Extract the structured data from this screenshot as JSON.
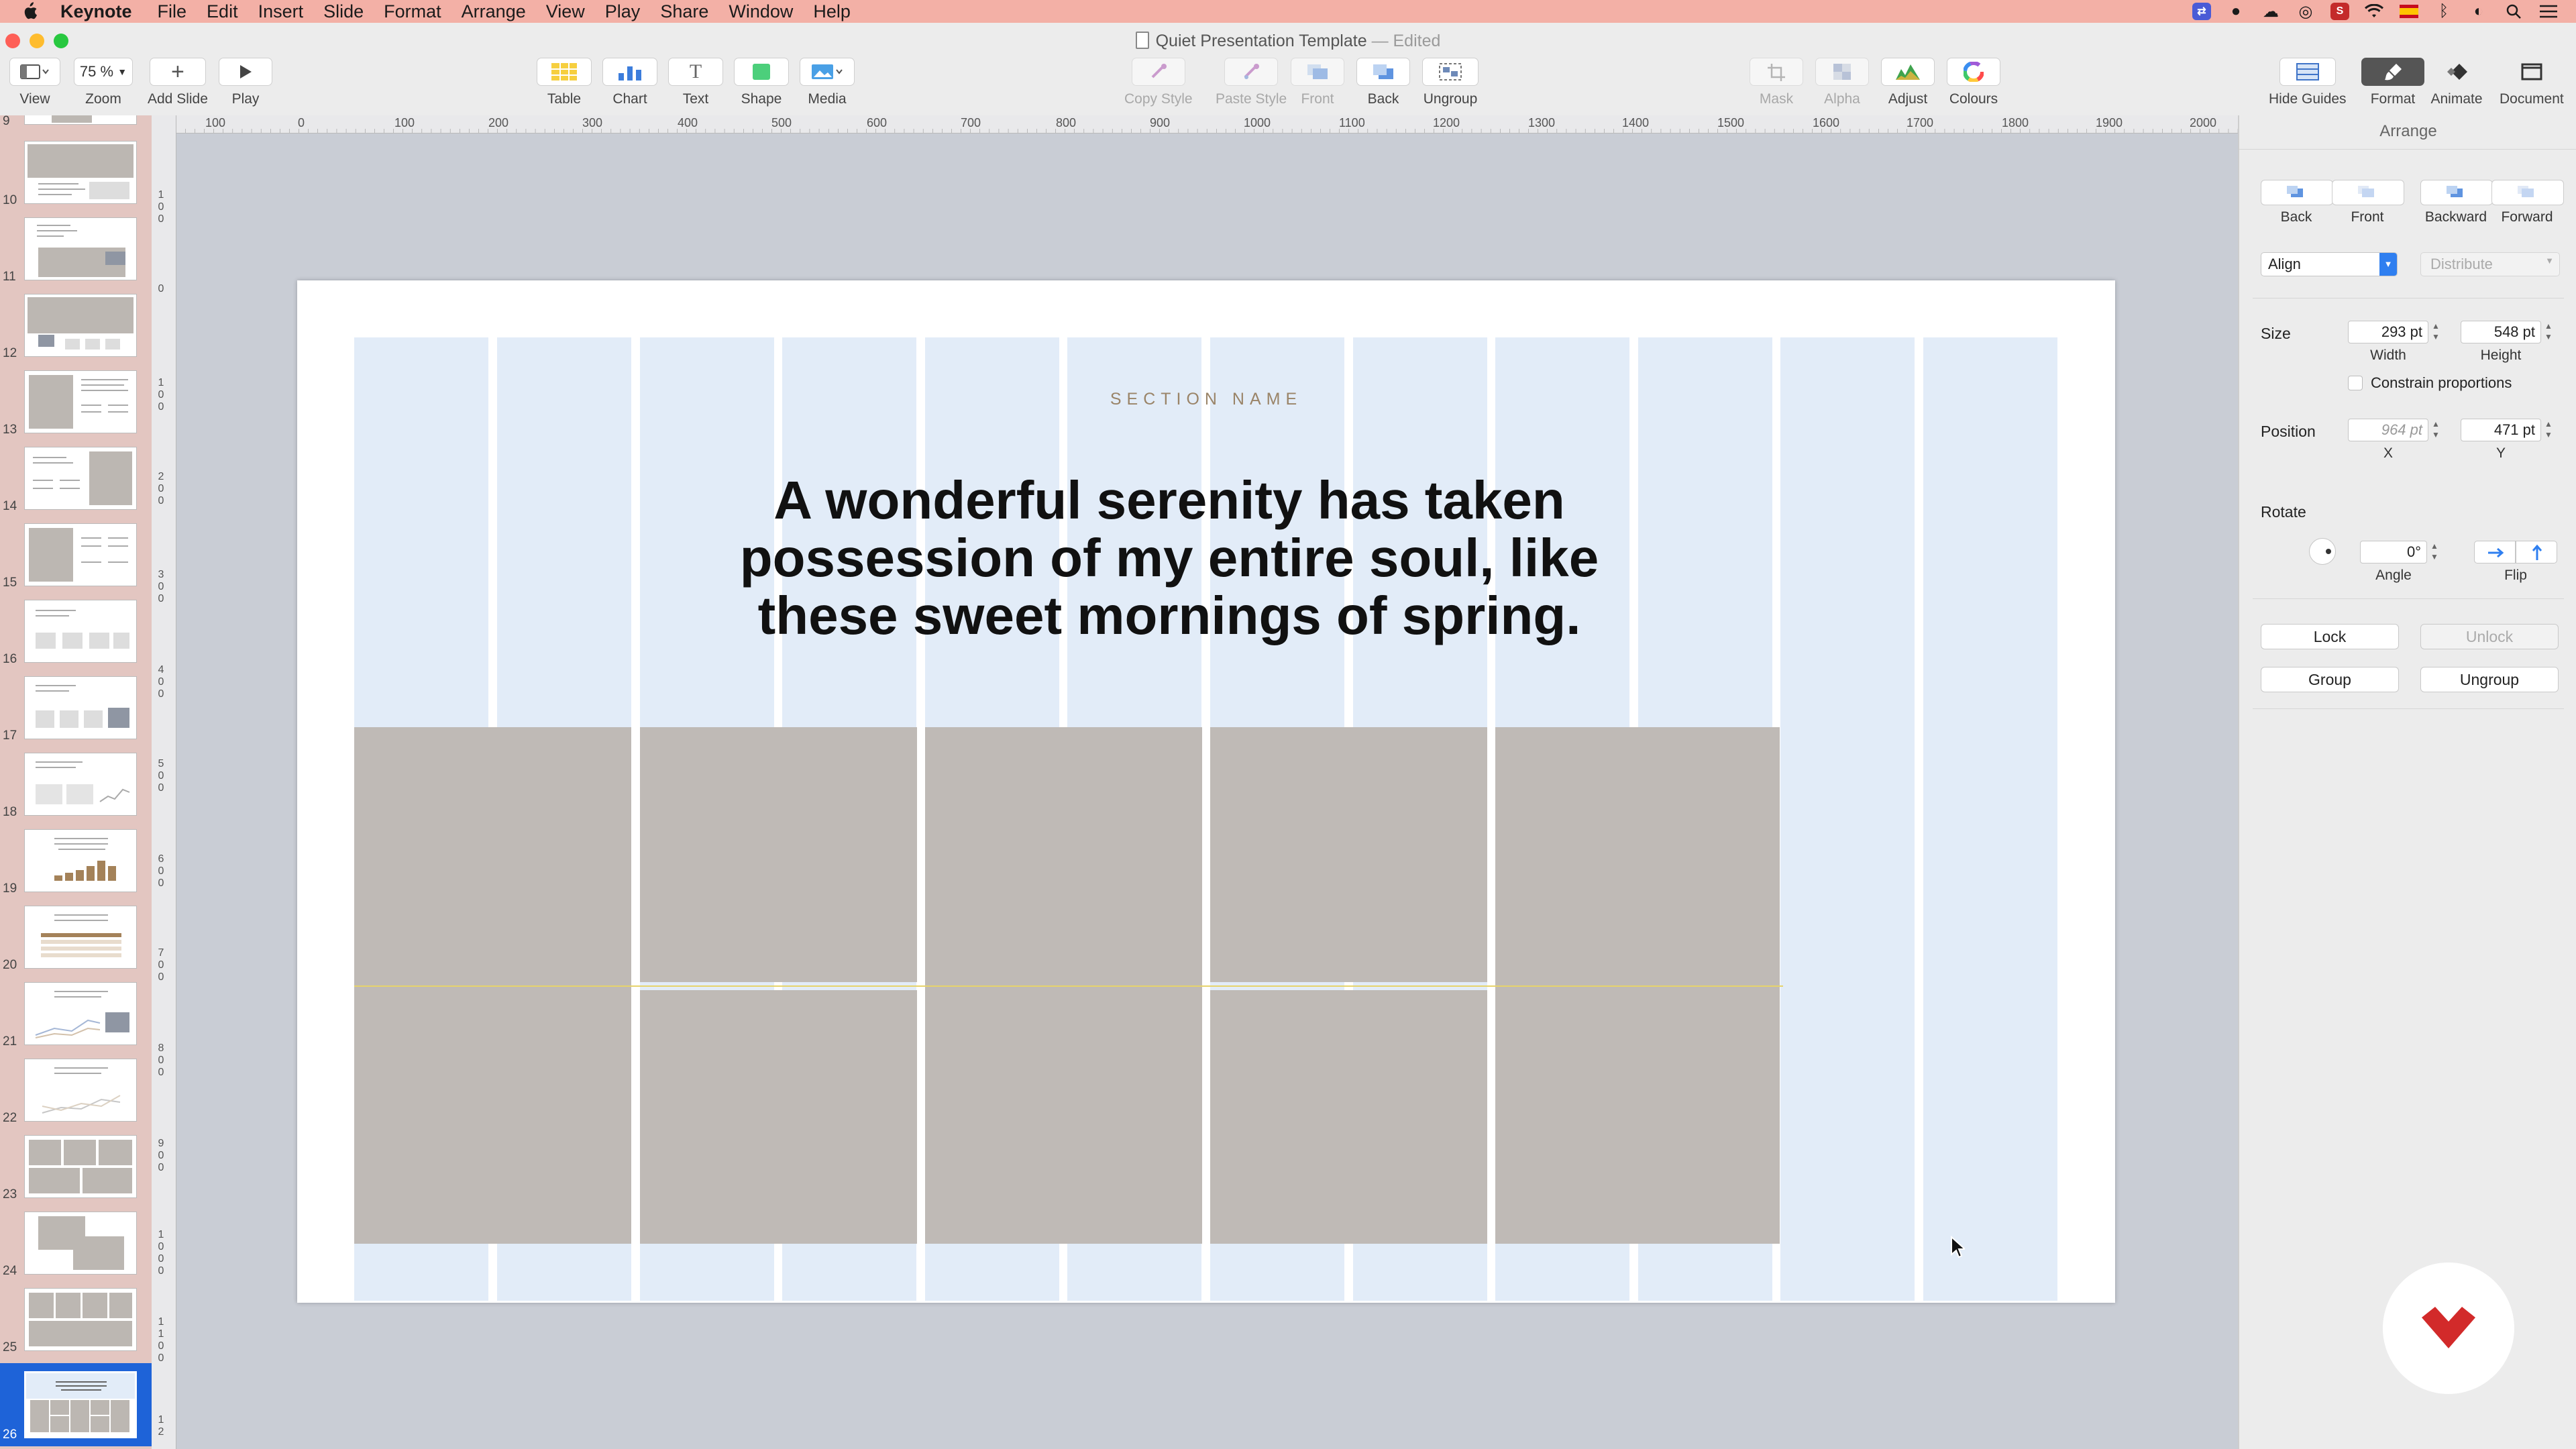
{
  "menubar": {
    "app": "Keynote",
    "items": [
      "File",
      "Edit",
      "Insert",
      "Slide",
      "Format",
      "Arrange",
      "View",
      "Play",
      "Share",
      "Window",
      "Help"
    ]
  },
  "window": {
    "title": "Quiet Presentation Template",
    "status": "— Edited"
  },
  "toolbar": {
    "view": "View",
    "zoom": "Zoom",
    "zoom_value": "75 %",
    "add_slide": "Add Slide",
    "play": "Play",
    "table": "Table",
    "chart": "Chart",
    "text": "Text",
    "shape": "Shape",
    "media": "Media",
    "copy_style": "Copy Style",
    "paste_style": "Paste Style",
    "front": "Front",
    "back": "Back",
    "ungroup": "Ungroup",
    "mask": "Mask",
    "alpha": "Alpha",
    "adjust": "Adjust",
    "colours": "Colours",
    "hide_guides": "Hide Guides",
    "format": "Format",
    "animate": "Animate",
    "document": "Document",
    "text_glyph": "T"
  },
  "navigator": {
    "slide_numbers": [
      "9",
      "10",
      "11",
      "12",
      "13",
      "14",
      "15",
      "16",
      "17",
      "18",
      "19",
      "20",
      "21",
      "22",
      "23",
      "24",
      "25",
      "26"
    ],
    "selected": "26"
  },
  "ruler": {
    "top_labels": [
      "100",
      "0",
      "100",
      "200",
      "300",
      "400",
      "500",
      "600",
      "700",
      "800",
      "900",
      "1000",
      "1100",
      "1200",
      "1300",
      "1400",
      "1500",
      "1600",
      "1700",
      "1800",
      "1900",
      "2000"
    ],
    "left_labels": [
      "100",
      "0",
      "100",
      "200",
      "300",
      "400",
      "500",
      "600",
      "700",
      "800",
      "900",
      "1000",
      "1100",
      "12"
    ]
  },
  "slide": {
    "section_name": "SECTION NAME",
    "headline": "A wonderful serenity has taken possession of my entire soul, like these sweet mornings of spring.",
    "colors": {
      "guide": "#e2ecf8",
      "photo_placeholder": "#bfbab6",
      "section_text": "#9a8468"
    }
  },
  "inspector": {
    "title": "Arrange",
    "back": "Back",
    "front": "Front",
    "backward": "Backward",
    "forward": "Forward",
    "align": "Align",
    "distribute": "Distribute",
    "size_label": "Size",
    "width_value": "293 pt",
    "height_value": "548 pt",
    "width_label": "Width",
    "height_label": "Height",
    "constrain": "Constrain proportions",
    "position_label": "Position",
    "x_value": "964 pt",
    "y_value": "471 pt",
    "x_label": "X",
    "y_label": "Y",
    "rotate_label": "Rotate",
    "angle_value": "0°",
    "angle_label": "Angle",
    "flip_label": "Flip",
    "lock": "Lock",
    "unlock": "Unlock",
    "group": "Group",
    "ungroup": "Ungroup"
  },
  "colors": {
    "menubar": "#f3b0a6",
    "navigator": "#e3c6c1",
    "selection": "#1e63d8",
    "brand_logo": "#d22a2a"
  }
}
